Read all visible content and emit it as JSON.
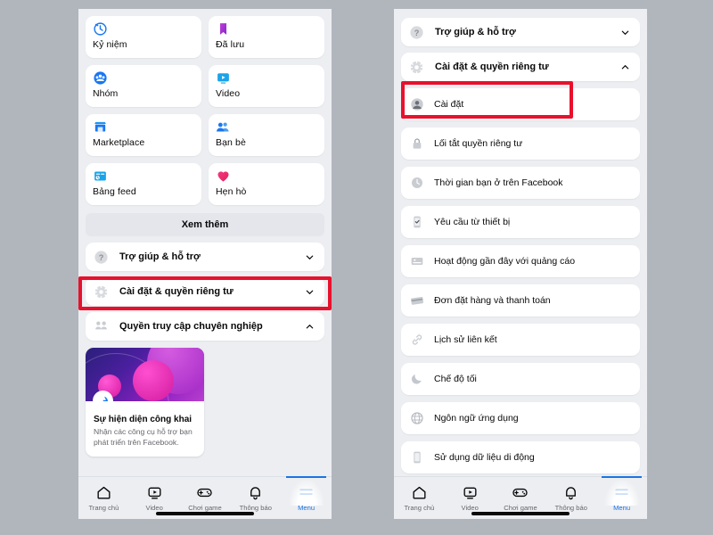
{
  "background_color": "#b1b5bc",
  "accent_color": "#1b74e4",
  "highlight_color": "#e8112d",
  "left_phone": {
    "tiles": [
      {
        "label": "Kỷ niệm",
        "icon": "clock-icon"
      },
      {
        "label": "Đã lưu",
        "icon": "bookmark-icon"
      },
      {
        "label": "Nhóm",
        "icon": "groups-icon"
      },
      {
        "label": "Video",
        "icon": "video-icon"
      },
      {
        "label": "Marketplace",
        "icon": "storefront-icon"
      },
      {
        "label": "Bạn bè",
        "icon": "friends-icon"
      },
      {
        "label": "Bảng feed",
        "icon": "feeds-icon"
      },
      {
        "label": "Hẹn hò",
        "icon": "heart-icon"
      }
    ],
    "see_more_label": "Xem thêm",
    "accordions": [
      {
        "label": "Trợ giúp & hỗ trợ",
        "icon": "question-circle-icon",
        "chevron": "chevron-down-icon",
        "expanded": false,
        "highlighted": false
      },
      {
        "label": "Cài đặt & quyền riêng tư",
        "icon": "gear-icon",
        "chevron": "chevron-down-icon",
        "expanded": false,
        "highlighted": true
      },
      {
        "label": "Quyền truy cập chuyên nghiệp",
        "icon": "people-icon",
        "chevron": "chevron-up-icon",
        "expanded": true,
        "highlighted": false
      }
    ],
    "promo": {
      "badge_icon": "rocket-icon",
      "title": "Sự hiện diện công khai",
      "subtitle": "Nhận các công cụ hỗ trợ bạn phát triển trên Facebook."
    }
  },
  "right_phone": {
    "accordions": [
      {
        "label": "Trợ giúp & hỗ trợ",
        "icon": "question-circle-icon",
        "chevron": "chevron-down-icon",
        "expanded": false
      },
      {
        "label": "Cài đặt & quyền riêng tư",
        "icon": "gear-icon",
        "chevron": "chevron-up-icon",
        "expanded": true
      }
    ],
    "settings_items": [
      {
        "label": "Cài đặt",
        "icon": "avatar-icon",
        "highlighted": true
      },
      {
        "label": "Lối tắt quyền riêng tư",
        "icon": "lock-icon",
        "highlighted": false
      },
      {
        "label": "Thời gian bạn ở trên Facebook",
        "icon": "clock-icon",
        "highlighted": false
      },
      {
        "label": "Yêu cầu từ thiết bị",
        "icon": "phone-check-icon",
        "highlighted": false
      },
      {
        "label": "Hoạt động gần đây với quảng cáo",
        "icon": "ad-activity-icon",
        "highlighted": false
      },
      {
        "label": "Đơn đặt hàng và thanh toán",
        "icon": "card-icon",
        "highlighted": false
      },
      {
        "label": "Lịch sử liên kết",
        "icon": "link-icon",
        "highlighted": false
      },
      {
        "label": "Chế độ tối",
        "icon": "moon-icon",
        "highlighted": false
      },
      {
        "label": "Ngôn ngữ ứng dụng",
        "icon": "globe-icon",
        "highlighted": false
      },
      {
        "label": "Sử dụng dữ liệu di động",
        "icon": "mobile-icon",
        "highlighted": false
      }
    ]
  },
  "bottom_nav": {
    "items": [
      {
        "label": "Trang chủ",
        "icon": "home-icon",
        "active": false
      },
      {
        "label": "Video",
        "icon": "video-icon",
        "active": false
      },
      {
        "label": "Chơi game",
        "icon": "gamepad-icon",
        "active": false
      },
      {
        "label": "Thông báo",
        "icon": "bell-icon",
        "active": false
      },
      {
        "label": "Menu",
        "icon": "menu-icon",
        "active": true
      }
    ]
  }
}
